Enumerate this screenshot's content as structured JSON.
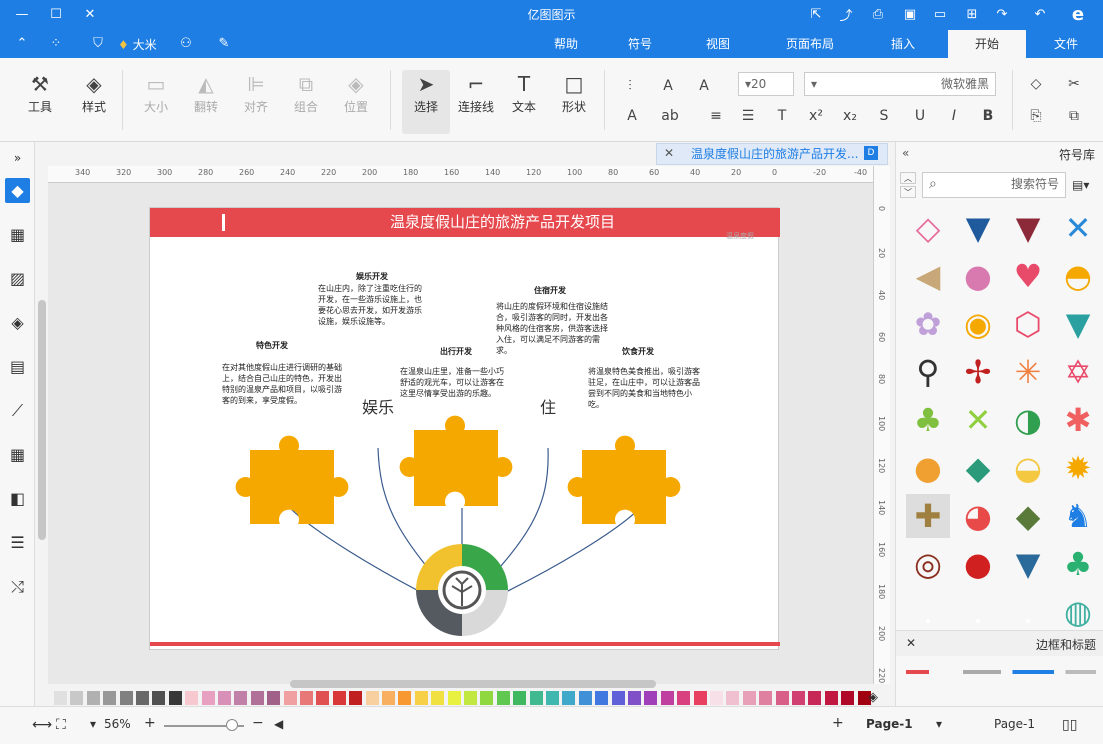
{
  "window": {
    "title": "亿图图示",
    "right_logo": "e"
  },
  "tabs": {
    "file": "文件",
    "start": "开始",
    "insert": "插入",
    "page_layout": "页面布局",
    "view": "视图",
    "symbol": "符号",
    "help": "帮助"
  },
  "account": {
    "user": "大米"
  },
  "toolbar": {
    "font_name": "微软雅黑",
    "font_size": "20",
    "btn_shape": "形状",
    "btn_text": "文本",
    "btn_connector": "连接线",
    "btn_select": "选择",
    "btn_position": "位置",
    "btn_group": "组合",
    "btn_align": "对齐",
    "btn_flip": "翻转",
    "btn_size": "大小",
    "btn_style": "样式",
    "btn_tools": "工具"
  },
  "doc": {
    "tab_title": "温泉度假山庄的旅游产品开发..."
  },
  "ruler": {
    "h": [
      "-40",
      "-20",
      "0",
      "20",
      "40",
      "60",
      "80",
      "100",
      "120",
      "140",
      "160",
      "180",
      "200",
      "220",
      "240",
      "260",
      "280",
      "300",
      "320",
      "340"
    ],
    "v": [
      "0",
      "20",
      "40",
      "60",
      "80",
      "100",
      "120",
      "140",
      "160",
      "180",
      "200",
      "220",
      "240"
    ]
  },
  "diagram": {
    "title": "温泉度假山庄的旅游产品开发项目",
    "corner": "温泉度假",
    "blocks": [
      {
        "head": "娱乐开发",
        "body": "在山庄内，除了注重吃住行的开发，在一些游乐设施上，也要花心思去开发，如开发游乐设施，娱乐设施等。"
      },
      {
        "head": "住宿开发",
        "body": "将山庄的度假环境和住宿设施结合，吸引游客的同时，开发出各种风格的住宿客房，供游客选择入住，可以满足不同游客的需求。"
      },
      {
        "head": "特色开发",
        "body": "在对其他度假山庄进行调研的基础上，结合自己山庄的特色，开发出特别的温泉产品和项目，以吸引游客的到来，享受度假。"
      },
      {
        "head": "出行开发",
        "body": "在温泉山庄里，准备一些小巧舒适的观光车，可以让游客在这里尽情享受出游的乐趣。"
      },
      {
        "head": "饮食开发",
        "body": "将温泉特色美食推出，吸引游客驻足，在山庄中，可以让游客品尝到不同的美食和当地特色小吃。"
      }
    ],
    "labels": {
      "play": "娱乐",
      "stay": "住"
    }
  },
  "right_panel": {
    "title": "符号库",
    "search_placeholder": "搜索符号",
    "section2": "边框和标题"
  },
  "status": {
    "page_label": "Page-1",
    "page_tab": "Page-1",
    "zoom": "56%"
  },
  "colors": {
    "accent": "#1e7ee4",
    "red": "#e5484d",
    "orange": "#f5a800"
  }
}
